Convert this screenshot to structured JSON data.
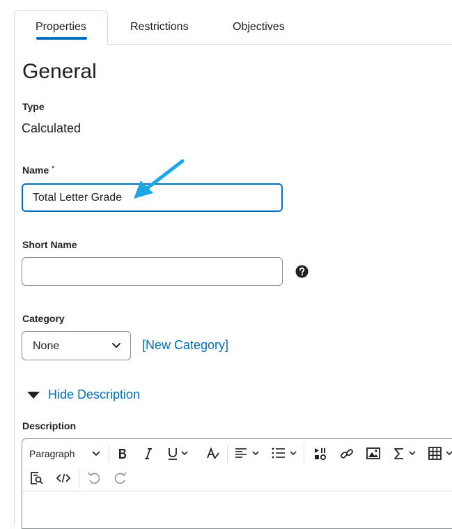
{
  "tabs": [
    {
      "label": "Properties",
      "active": true
    },
    {
      "label": "Restrictions",
      "active": false
    },
    {
      "label": "Objectives",
      "active": false
    }
  ],
  "section": {
    "title": "General"
  },
  "type": {
    "label": "Type",
    "value": "Calculated"
  },
  "name": {
    "label": "Name",
    "required_mark": "*",
    "value": "Total Letter Grade"
  },
  "short_name": {
    "label": "Short Name",
    "value": "",
    "help_icon": "help-circle-icon"
  },
  "category": {
    "label": "Category",
    "selected": "None",
    "new_link": "[New Category]"
  },
  "description_toggle": {
    "label": "Hide Description",
    "icon": "triangle-down-icon"
  },
  "description": {
    "label": "Description",
    "toolbar": {
      "format_select": "Paragraph",
      "buttons": [
        "bold-icon",
        "italic-icon",
        "underline-icon",
        "text-style-icon",
        "align-icon",
        "list-icon",
        "media-icon",
        "link-icon",
        "image-icon",
        "equation-icon",
        "table-icon",
        "find-replace-icon",
        "source-code-icon",
        "undo-icon",
        "redo-icon"
      ]
    }
  },
  "colors": {
    "accent": "#006fbf",
    "border": "#868c8f",
    "tab_border": "#d3d9e3",
    "annotation_arrow": "#1aa7e6"
  }
}
